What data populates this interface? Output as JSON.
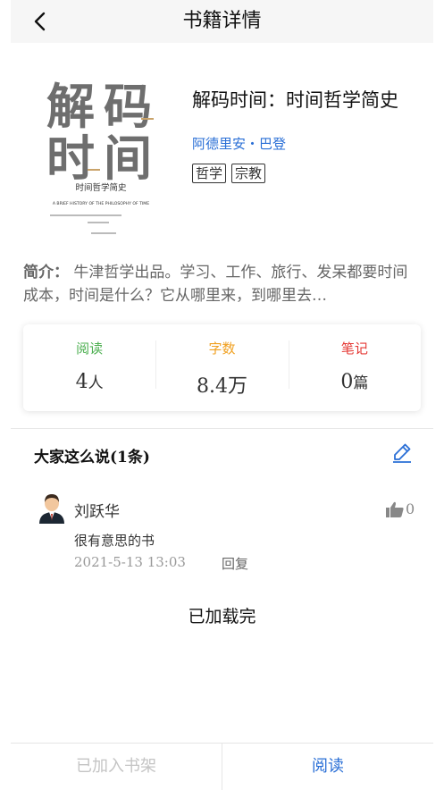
{
  "header": {
    "title": "书籍详情"
  },
  "book": {
    "title": "解码时间：时间哲学简史",
    "author": "阿德里安・巴登",
    "tags": [
      "哲学",
      "宗教"
    ],
    "cover": {
      "big_title": "解码时间",
      "cn_subtitle": "时间哲学简史",
      "en_subtitle": "A BRIEF HISTORY OF THE PHILOSOPHY OF TIME"
    },
    "intro_label": "简介：",
    "intro_text": "牛津哲学出品。学习、工作、旅行、发呆都要时间成本，时间是什么？它从哪里来，到哪里去…"
  },
  "stats": [
    {
      "label": "阅读",
      "value": "4",
      "unit": "人",
      "color": "#4caf50"
    },
    {
      "label": "字数",
      "value": "8.4万",
      "unit": "",
      "color": "#f0a020"
    },
    {
      "label": "笔记",
      "value": "0",
      "unit": "篇",
      "color": "#e53935"
    }
  ],
  "comments": {
    "title": "大家这么说(1条)",
    "items": [
      {
        "user": "刘跃华",
        "likes": "0",
        "text": "很有意思的书",
        "time": "2021-5-13  13:03",
        "reply": "回复"
      }
    ]
  },
  "loaded_text": "已加载完",
  "bottom": {
    "shelf_label": "已加入书架",
    "read_label": "阅读"
  }
}
